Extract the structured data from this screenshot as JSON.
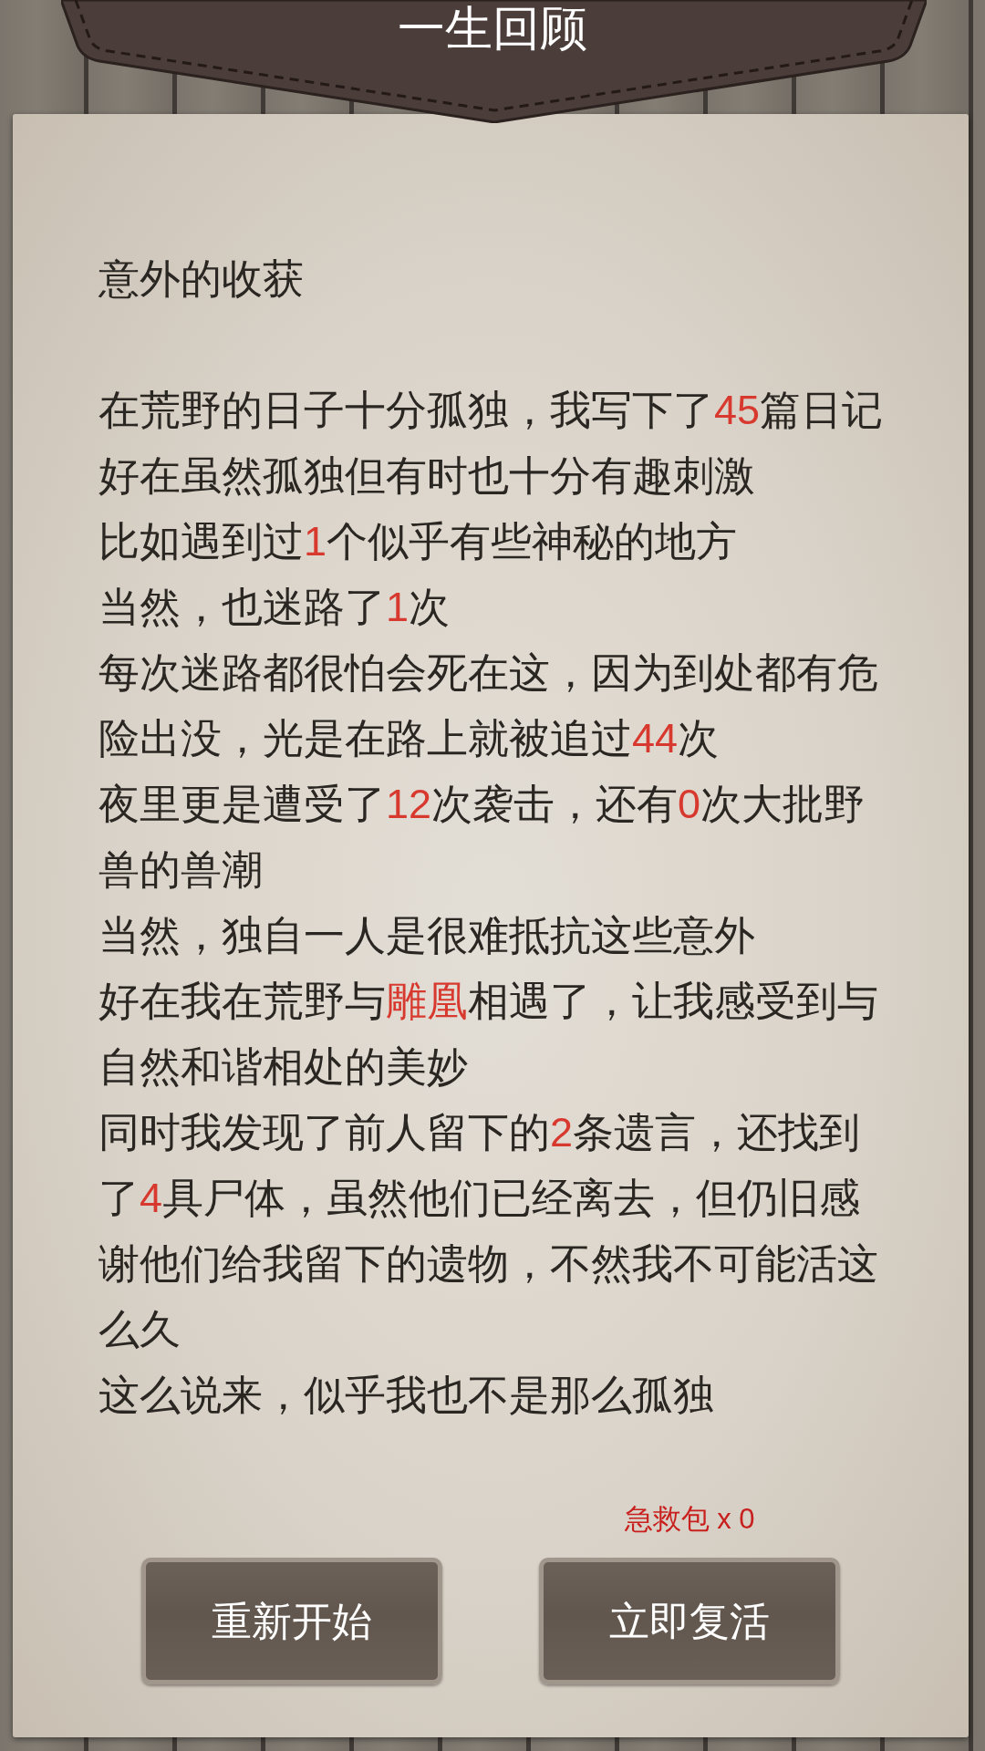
{
  "header": {
    "title": "一生回顾"
  },
  "story": {
    "heading": "意外的收获",
    "paragraphs": [
      {
        "segments": [
          {
            "text": "在荒野的日子十分孤独，我写下了",
            "highlight": false
          },
          {
            "text": "45",
            "highlight": true
          },
          {
            "text": "篇日记",
            "highlight": false
          }
        ]
      },
      {
        "segments": [
          {
            "text": "好在虽然孤独但有时也十分有趣刺激",
            "highlight": false
          }
        ]
      },
      {
        "segments": [
          {
            "text": "比如遇到过",
            "highlight": false
          },
          {
            "text": "1",
            "highlight": true
          },
          {
            "text": "个似乎有些神秘的地方",
            "highlight": false
          }
        ]
      },
      {
        "segments": [
          {
            "text": "当然，也迷路了",
            "highlight": false
          },
          {
            "text": "1",
            "highlight": true
          },
          {
            "text": "次",
            "highlight": false
          }
        ]
      },
      {
        "segments": [
          {
            "text": "每次迷路都很怕会死在这，因为到处都有危险出没，光是在路上就被追过",
            "highlight": false
          },
          {
            "text": "44",
            "highlight": true
          },
          {
            "text": "次",
            "highlight": false
          }
        ]
      },
      {
        "segments": [
          {
            "text": "夜里更是遭受了",
            "highlight": false
          },
          {
            "text": "12",
            "highlight": true
          },
          {
            "text": "次袭击，还有",
            "highlight": false
          },
          {
            "text": "0",
            "highlight": true
          },
          {
            "text": "次大批野兽的兽潮",
            "highlight": false
          }
        ]
      },
      {
        "segments": [
          {
            "text": "当然，独自一人是很难抵抗这些意外",
            "highlight": false
          }
        ]
      },
      {
        "segments": [
          {
            "text": "好在我在荒野与",
            "highlight": false
          },
          {
            "text": "雕凰",
            "highlight": true
          },
          {
            "text": "相遇了，让我感受到与自然和谐相处的美妙",
            "highlight": false
          }
        ]
      },
      {
        "segments": [
          {
            "text": "同时我发现了前人留下的",
            "highlight": false
          },
          {
            "text": "2",
            "highlight": true
          },
          {
            "text": "条遗言，还找到了",
            "highlight": false
          },
          {
            "text": "4",
            "highlight": true
          },
          {
            "text": "具尸体，虽然他们已经离去，但仍旧感谢他们给我留下的遗物，不然我不可能活这么久",
            "highlight": false
          }
        ]
      },
      {
        "segments": [
          {
            "text": "这么说来，似乎我也不是那么孤独",
            "highlight": false
          }
        ]
      }
    ]
  },
  "first_aid": {
    "text": "急救包 x 0"
  },
  "buttons": [
    {
      "label": "重新开始"
    },
    {
      "label": "立即复活"
    }
  ]
}
